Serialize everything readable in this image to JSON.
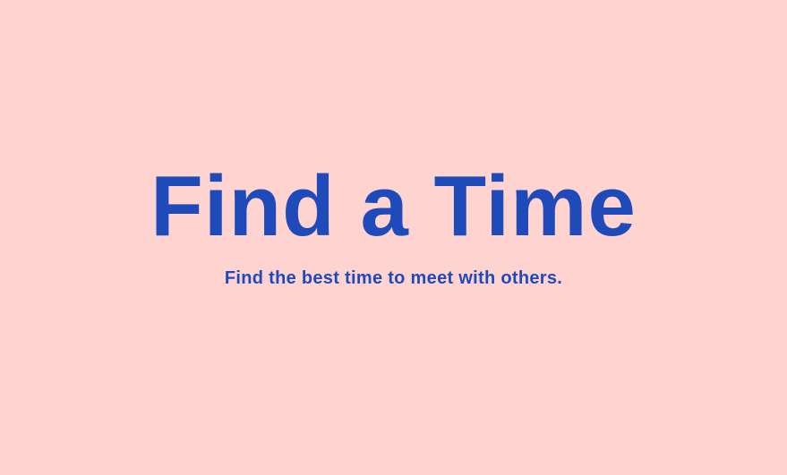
{
  "hero": {
    "title": "Find a Time",
    "subtitle": "Find the best time to meet with others."
  },
  "colors": {
    "background": "#ffd3d0",
    "text": "#1f4bba"
  }
}
